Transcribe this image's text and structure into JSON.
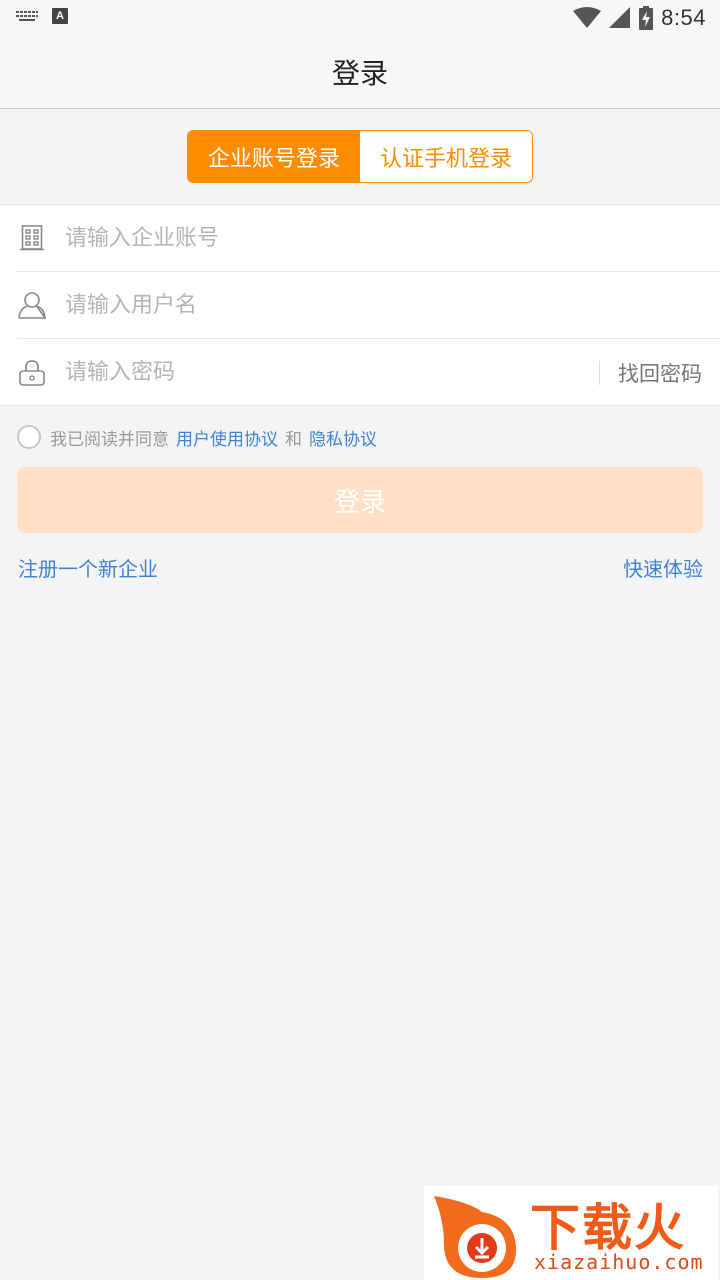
{
  "status_bar": {
    "time": "8:54",
    "icons": [
      "keyboard-icon",
      "a-badge-icon",
      "wifi-icon",
      "signal-icon",
      "battery-charging-icon"
    ],
    "a_badge": "A"
  },
  "header": {
    "title": "登录"
  },
  "login_tabs": [
    {
      "label": "企业账号登录",
      "active": true
    },
    {
      "label": "认证手机登录",
      "active": false
    }
  ],
  "form": {
    "company": {
      "placeholder": "请输入企业账号",
      "value": "",
      "icon": "building-icon"
    },
    "username": {
      "placeholder": "请输入用户名",
      "value": "",
      "icon": "user-icon"
    },
    "password": {
      "placeholder": "请输入密码",
      "value": "",
      "icon": "lock-icon",
      "forgot_label": "找回密码"
    }
  },
  "agreement": {
    "prefix": "我已阅读并同意",
    "user_agreement": "用户使用协议",
    "conjunction": "和",
    "privacy_policy": "隐私协议",
    "checked": false
  },
  "login_button": {
    "label": "登录"
  },
  "links": {
    "register": "注册一个新企业",
    "quick_trial": "快速体验"
  },
  "watermark": {
    "title": "下载火",
    "url": "xiazaihuo.com"
  },
  "colors": {
    "accent": "#ff8c00",
    "link": "#3f83d6",
    "button_disabled": "#ffe0c6",
    "background": "#f4f4f4"
  }
}
